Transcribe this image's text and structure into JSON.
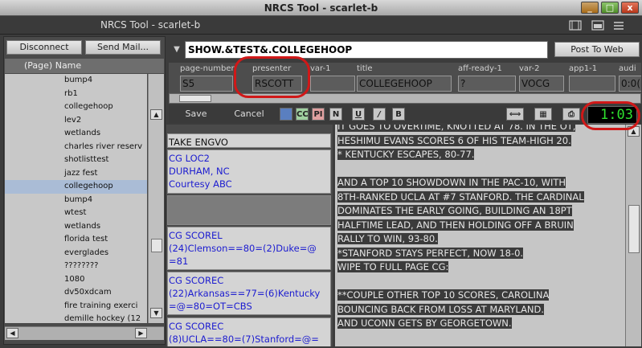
{
  "window": {
    "title": "NRCS Tool - scarlet-b",
    "subtitle": "NRCS Tool - scarlet-b"
  },
  "window_buttons": [
    "_",
    "□",
    "x"
  ],
  "left_panel": {
    "disconnect_label": "Disconnect",
    "send_mail_label": "Send Mail...",
    "column_header": "(Page) Name",
    "items": [
      {
        "label": "bump4",
        "selected": false
      },
      {
        "label": "rb1",
        "selected": false
      },
      {
        "label": "collegehoop",
        "selected": false
      },
      {
        "label": "lev2",
        "selected": false
      },
      {
        "label": "wetlands",
        "selected": false
      },
      {
        "label": "charles river reserv",
        "selected": false
      },
      {
        "label": "shotlisttest",
        "selected": false
      },
      {
        "label": "jazz fest",
        "selected": false
      },
      {
        "label": "collegehoop",
        "selected": true
      },
      {
        "label": "bump4",
        "selected": false
      },
      {
        "label": "wtest",
        "selected": false
      },
      {
        "label": "wetlands",
        "selected": false
      },
      {
        "label": "florida test",
        "selected": false
      },
      {
        "label": "everglades",
        "selected": false
      },
      {
        "label": "????????",
        "selected": false
      },
      {
        "label": "1080",
        "selected": false
      },
      {
        "label": "dv50xdcam",
        "selected": false
      },
      {
        "label": "fire training exerci",
        "selected": false
      },
      {
        "label": "demille hockey (12",
        "selected": false
      }
    ]
  },
  "story": {
    "title": "SHOW.&TEST&.COLLEGEHOOP",
    "post_label": "Post To Web",
    "fields": [
      {
        "label": "page-number",
        "value": "S5"
      },
      {
        "label": "presenter",
        "value": "RSCOTT"
      },
      {
        "label": "var-1",
        "value": ""
      },
      {
        "label": "title",
        "value": "COLLEGEHOOP"
      },
      {
        "label": "aff-ready-1",
        "value": "?"
      },
      {
        "label": "var-2",
        "value": "VOCG"
      },
      {
        "label": "app1-1",
        "value": ""
      },
      {
        "label": "audi",
        "value": "0:0("
      }
    ]
  },
  "toolbar": {
    "save_label": "Save",
    "cancel_label": "Cancel",
    "cc_label": "CC",
    "pi_label": "PI",
    "n_label": "N",
    "u_label": "U",
    "i_label": "/",
    "b_label": "B",
    "timer": "1:03"
  },
  "cues": [
    {
      "text": "TAKE ENGVO",
      "style": "black"
    },
    {
      "text": "CG LOC2\nDURHAM, NC\nCourtesy ABC",
      "style": "blue"
    },
    {
      "text": "",
      "style": "empty"
    },
    {
      "text": "CG SCOREL\n(24)Clemson==80=(2)Duke=@\n=81",
      "style": "blue"
    },
    {
      "text": "CG SCOREC\n(22)Arkansas==77=(6)Kentucky\n=@=80=OT=CBS",
      "style": "blue"
    },
    {
      "text": "CG SCOREC\n(8)UCLA==80=(7)Stanford=@=",
      "style": "blue"
    }
  ],
  "copy_lines": [
    "IT GOES TO OVERTIME, KNOTTED AT 78. IN THE OT,",
    "HESHIMU EVANS SCORES 6 OF HIS TEAM-HIGH 20.",
    "* KENTUCKY ESCAPES,  80-77.",
    "",
    "  AND A TOP 10 SHOWDOWN IN THE PAC-10, WITH",
    "8TH-RANKED UCLA AT #7 STANFORD.  THE CARDINAL",
    "DOMINATES THE EARLY GOING, BUILDING AN 18PT",
    "HALFTIME LEAD, AND THEN HOLDING OFF A BRUIN",
    "RALLY TO WIN, 93-80.",
    "*STANFORD STAYS PERFECT, NOW 18-0.",
    "WIPE TO FULL PAGE CG:",
    "",
    "**COUPLE OTHER TOP 10 SCORES, CAROLINA",
    "BOUNCING BACK FROM LOSS AT MARYLAND.",
    "  AND UCONN GETS BY GEORGETOWN."
  ],
  "colors": {
    "highlight": "#d01818",
    "timer": "#2ee02e",
    "selected_row": "#aabcd6",
    "cue_text": "#1c1cd0"
  }
}
